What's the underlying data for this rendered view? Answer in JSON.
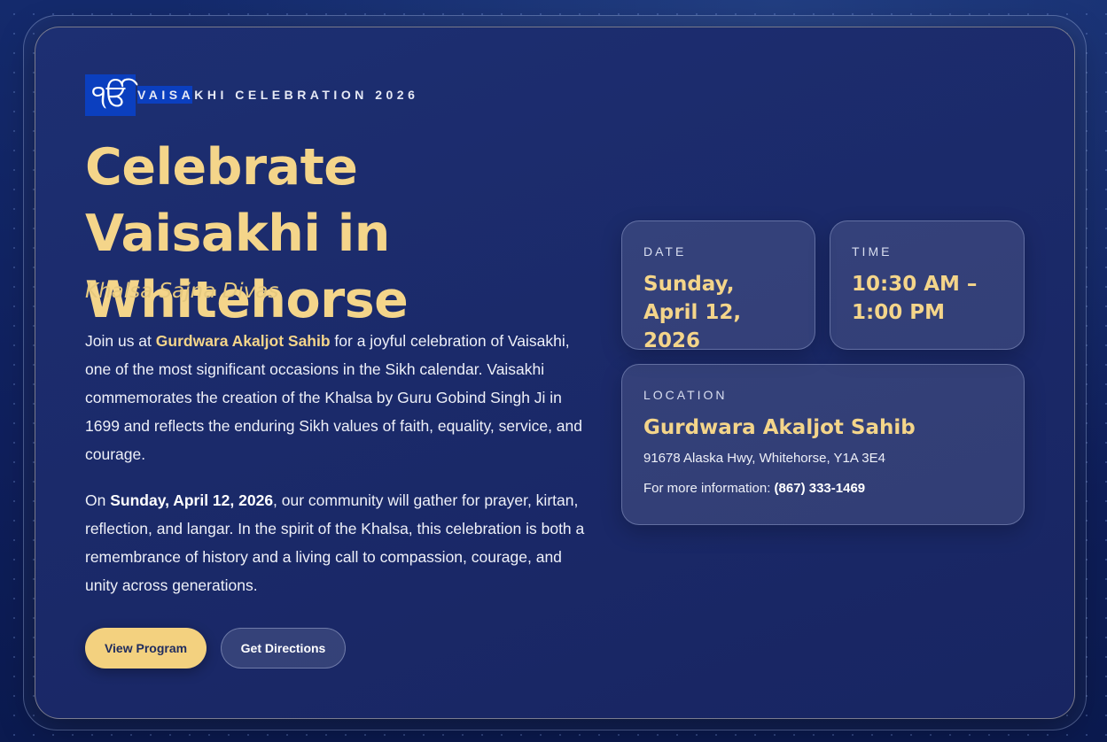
{
  "eyebrow": {
    "emblem": "ੴ",
    "text": "VAISAKHI CELEBRATION 2026"
  },
  "hero": {
    "title": "Celebrate Vaisakhi in Whitehorse",
    "subtitle": "Khalsa Sajna Divas"
  },
  "intro": {
    "p1_before": "Join us at ",
    "p1_highlight": "Gurdwara Akaljot Sahib",
    "p1_after": " for a joyful celebration of Vaisakhi, one of the most significant occasions in the Sikh calendar. Vaisakhi commemorates the creation of the Khalsa by Guru Gobind Singh Ji in 1699 and reflects the enduring Sikh values of faith, equality, service, and courage.",
    "p2_before": "On ",
    "p2_bold": "Sunday, April 12, 2026",
    "p2_after": ", our community will gather for prayer, kirtan, reflection, and langar. In the spirit of the Khalsa, this celebration is both a remembrance of history and a living call to compassion, courage, and unity across generations."
  },
  "actions": {
    "primary_label": "View Program",
    "secondary_label": "Get Directions"
  },
  "details": {
    "date_label": "DATE",
    "date_value": "Sunday, April 12, 2026",
    "time_label": "TIME",
    "time_value": "10:30 AM – 1:00 PM",
    "location_label": "LOCATION",
    "location_name": "Gurdwara Akaljot Sahib",
    "address": "91678 Alaska Hwy, Whitehorse, Y1A 3E4",
    "more_info_label": "For more information: ",
    "phone": "(867) 333-1469"
  },
  "colors": {
    "accent_gold": "#f4d58a",
    "background_navy": "#1b2a6a",
    "emblem_blue": "#0b3fbf"
  }
}
